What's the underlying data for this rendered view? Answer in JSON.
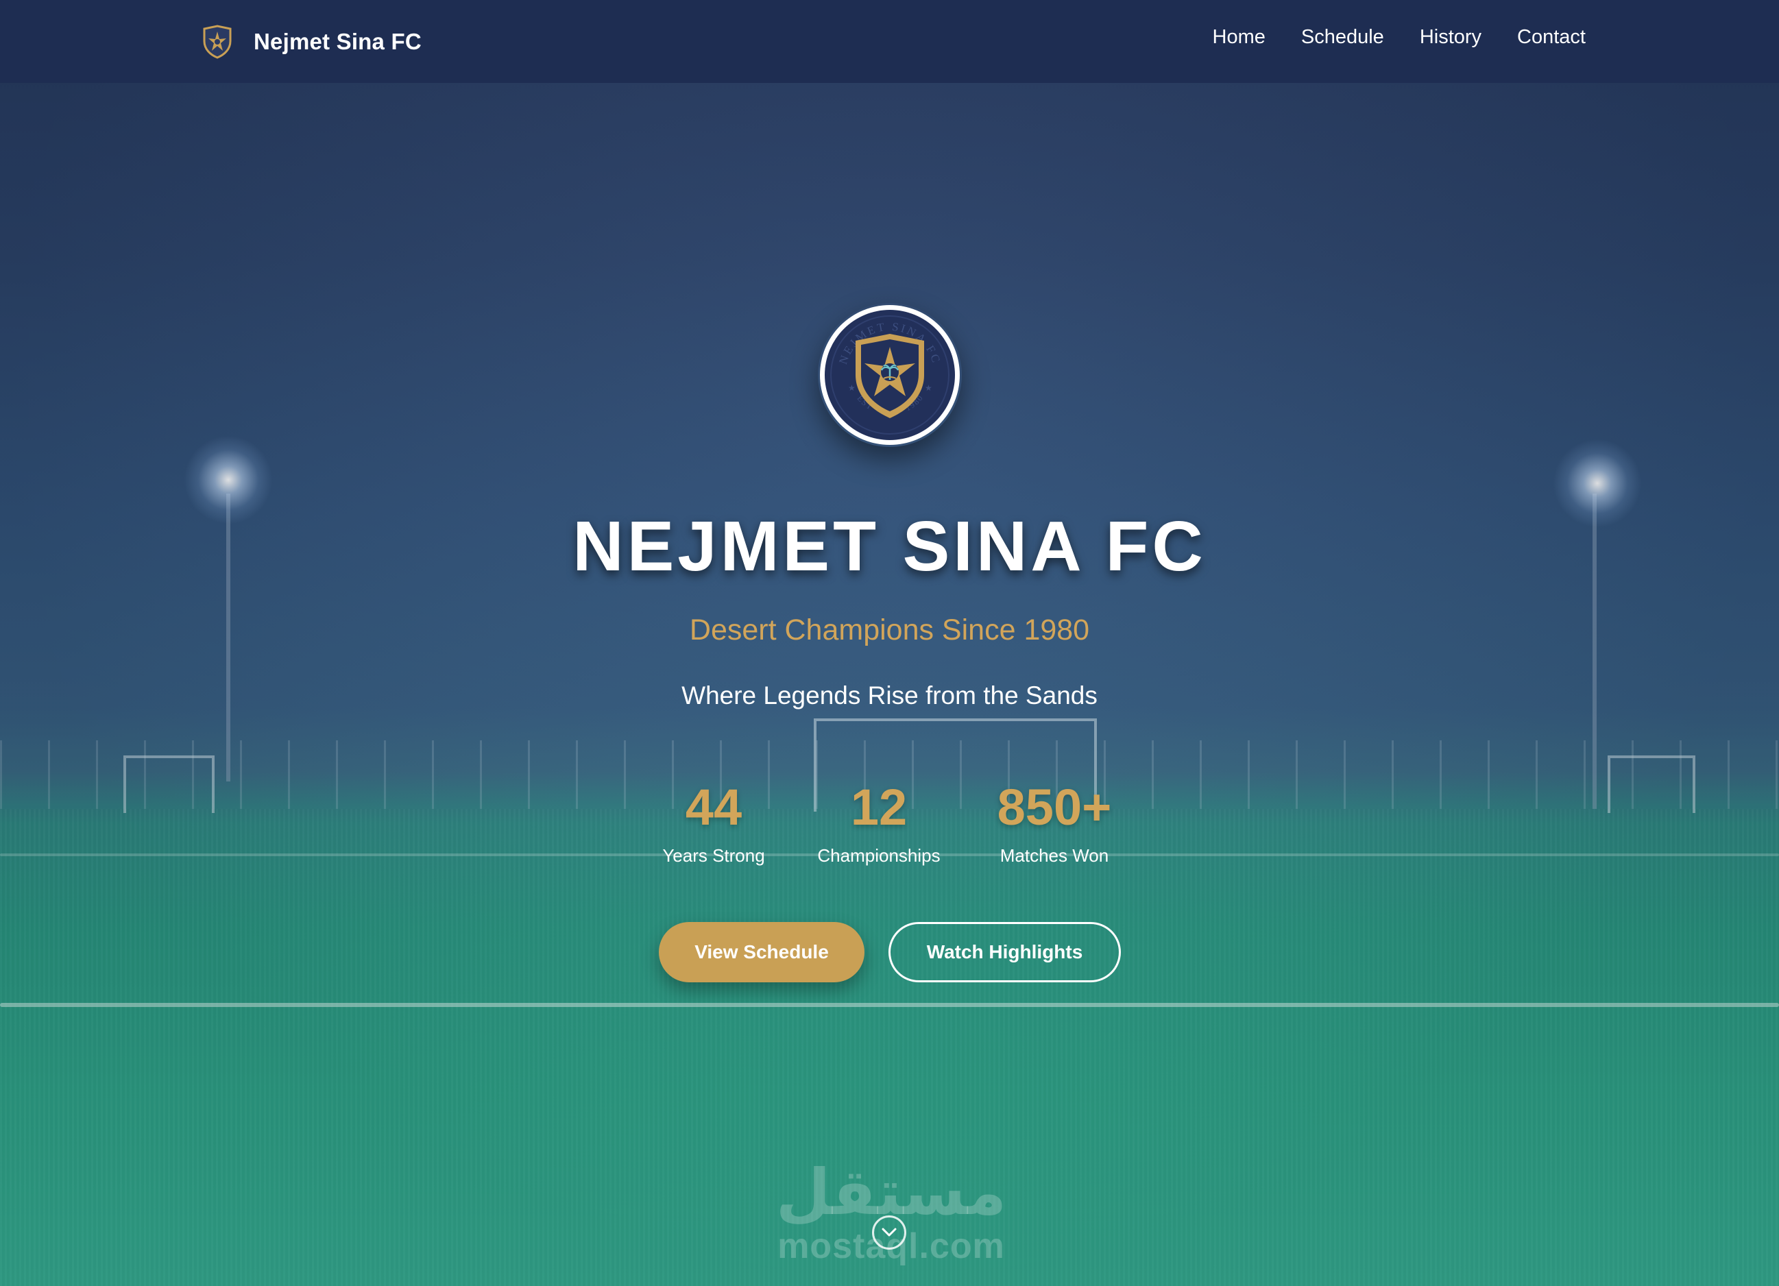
{
  "navbar": {
    "brand_name": "Nejmet Sina FC",
    "logo_icon": "crest-icon",
    "links": [
      {
        "label": "Home"
      },
      {
        "label": "Schedule"
      },
      {
        "label": "History"
      },
      {
        "label": "Contact"
      }
    ]
  },
  "hero": {
    "crest_icon": "club-crest-icon",
    "crest_ring_text": "NEJMET SINA FC",
    "crest_est_text": "EST",
    "crest_year_text": "1980",
    "title": "NEJMET SINA FC",
    "subtitle": "Desert Champions Since 1980",
    "tagline": "Where Legends Rise from the Sands",
    "stats": [
      {
        "value": "44",
        "label": "Years Strong"
      },
      {
        "value": "12",
        "label": "Championships"
      },
      {
        "value": "850+",
        "label": "Matches Won"
      }
    ],
    "primary_button": "View Schedule",
    "secondary_button": "Watch Highlights",
    "scroll_icon": "chevron-down-icon"
  },
  "watermark": {
    "arabic": "مستقل",
    "latin": "mostaql.com"
  },
  "colors": {
    "navbar_bg": "#1e2d52",
    "accent_gold": "#c9a055",
    "text_gold": "#d2a55a",
    "text_white": "#ffffff",
    "crest_navy": "#22305a"
  }
}
